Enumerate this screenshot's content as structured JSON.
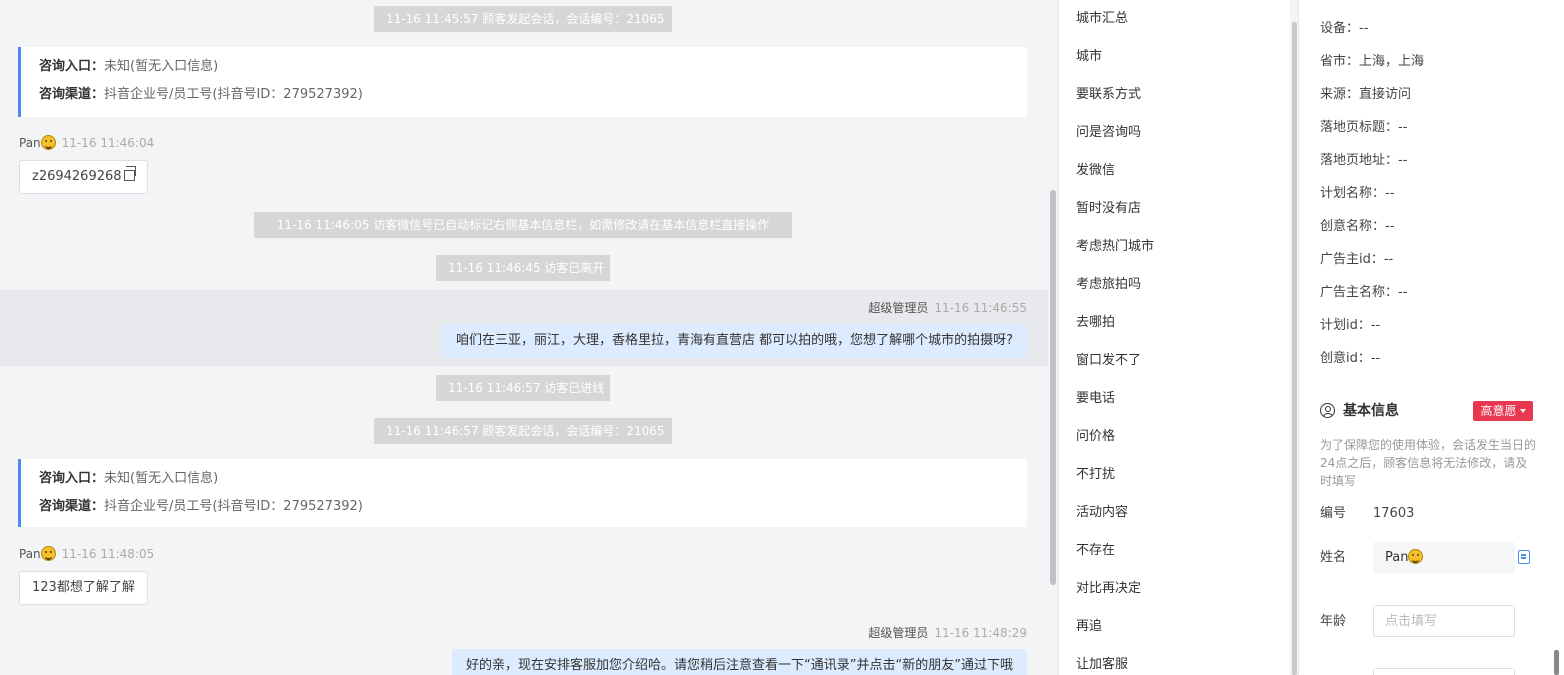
{
  "chat": {
    "sys1": "11-16 11:45:57 顾客发起会话，会话编号：21065",
    "card1": {
      "entry_label": "咨询入口：",
      "entry_value": "未知(暂无入口信息)",
      "channel_label": "咨询渠道：",
      "channel_value": "抖音企业号/员工号(抖音号ID：279527392)"
    },
    "msg1": {
      "sender": "Pan",
      "time": "11-16 11:46:04",
      "text": "z2694269268"
    },
    "sys2": "11-16 11:46:05 访客微信号已自动标记右侧基本信息栏，如需修改请在基本信息栏直接操作",
    "sys3": "11-16 11:46:45 访客已离开",
    "msg2": {
      "sender": "超级管理员",
      "time": "11-16 11:46:55",
      "text": "咱们在三亚，丽江，大理，香格里拉，青海有直营店 都可以拍的哦，您想了解哪个城市的拍摄呀?"
    },
    "sys4": "11-16 11:46:57 访客已进线",
    "sys5": "11-16 11:46:57 顾客发起会话，会话编号：21065",
    "card2": {
      "entry_label": "咨询入口：",
      "entry_value": "未知(暂无入口信息)",
      "channel_label": "咨询渠道：",
      "channel_value": "抖音企业号/员工号(抖音号ID：279527392)"
    },
    "msg3": {
      "sender": "Pan",
      "time": "11-16 11:48:05",
      "text": "123都想了解了解"
    },
    "msg4": {
      "sender": "超级管理员",
      "time": "11-16 11:48:29",
      "text": "好的亲，现在安排客服加您介绍哈。请您稍后注意查看一下“通讯录”并点击“新的朋友”通过下哦"
    }
  },
  "tags": [
    "城市汇总",
    "城市",
    "要联系方式",
    "问是咨询吗",
    "发微信",
    "暂时没有店",
    "考虑热门城市",
    "考虑旅拍吗",
    "去哪拍",
    "窗口发不了",
    "要电话",
    "问价格",
    "不打扰",
    "活动内容",
    "不存在",
    "对比再决定",
    "再追",
    "让加客服"
  ],
  "panel": {
    "fields": [
      "设备：--",
      "省市：上海，上海",
      "来源：直接访问",
      "落地页标题：--",
      "落地页地址：--",
      "计划名称：--",
      "创意名称：--",
      "广告主id：--",
      "广告主名称：--",
      "计划id：--",
      "创意id：--"
    ],
    "basic_title": "基本信息",
    "intent": "高意愿",
    "notice": "为了保障您的使用体验，会话发生当日的24点之后，顾客信息将无法修改，请及时填写",
    "id_label": "编号",
    "id_value": "17603",
    "name_label": "姓名",
    "name_value": "Pan",
    "age_label": "年龄",
    "age_placeholder": "点击填写"
  }
}
